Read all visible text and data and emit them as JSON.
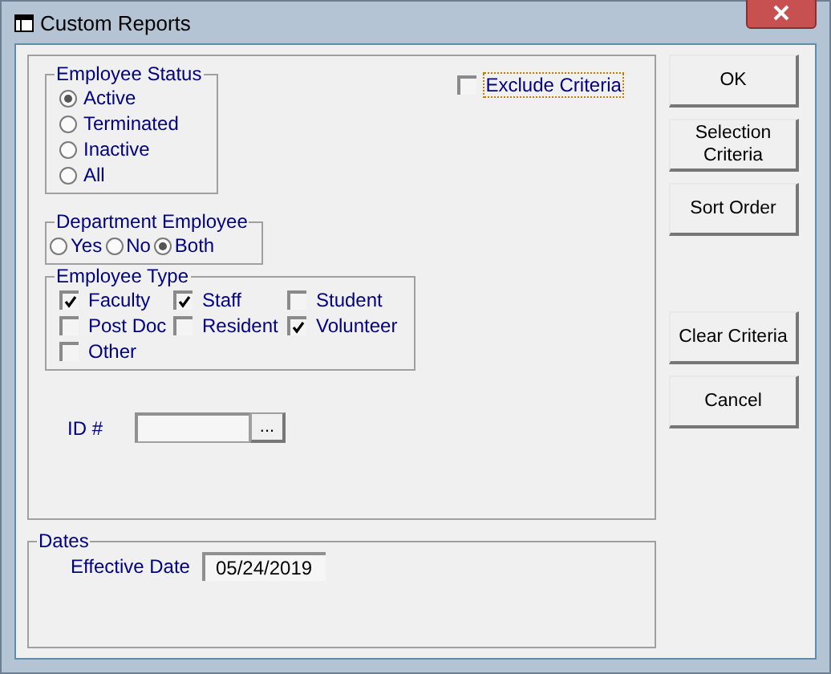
{
  "window": {
    "title": "Custom Reports"
  },
  "employee_status": {
    "title": "Employee Status",
    "options": [
      {
        "label": "Active",
        "selected": true
      },
      {
        "label": "Terminated",
        "selected": false
      },
      {
        "label": "Inactive",
        "selected": false
      },
      {
        "label": "All",
        "selected": false
      }
    ]
  },
  "exclude_criteria": {
    "label": "Exclude Criteria",
    "checked": false
  },
  "department_employee": {
    "title": "Department Employee",
    "options": [
      {
        "label": "Yes",
        "selected": false
      },
      {
        "label": "No",
        "selected": false
      },
      {
        "label": "Both",
        "selected": true
      }
    ]
  },
  "employee_type": {
    "title": "Employee Type",
    "options": [
      {
        "label": "Faculty",
        "checked": true
      },
      {
        "label": "Staff",
        "checked": true
      },
      {
        "label": "Student",
        "checked": false
      },
      {
        "label": "Post Doc",
        "checked": false
      },
      {
        "label": "Resident",
        "checked": false
      },
      {
        "label": "Volunteer",
        "checked": true
      },
      {
        "label": "Other",
        "checked": false
      }
    ]
  },
  "id_field": {
    "label": "ID #",
    "browse_button": "..."
  },
  "dates": {
    "title": "Dates",
    "effective_date_label": "Effective Date",
    "effective_date": "05/24/2019"
  },
  "actions": [
    "OK",
    "Selection Criteria",
    "Sort Order"
  ],
  "criteria_actions": [
    "Clear Criteria",
    "Cancel"
  ]
}
